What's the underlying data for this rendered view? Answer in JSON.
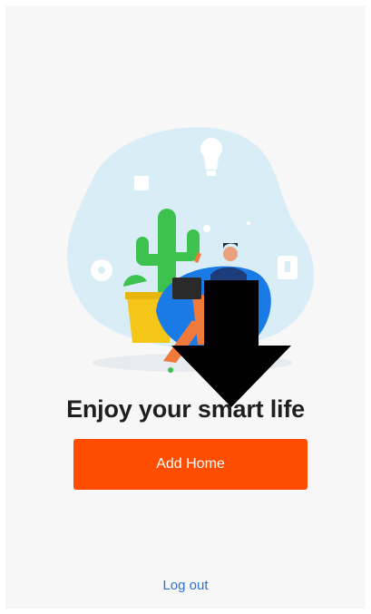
{
  "headline": "Enjoy your smart life",
  "add_home_label": "Add Home",
  "logout_label": "Log out",
  "colors": {
    "background": "#f7f7f7",
    "primary_button": "#ff4d00",
    "link": "#2f6fd6",
    "headline": "#1f1f1f"
  },
  "icons": [
    "smart-home-illustration",
    "down-arrow-icon"
  ]
}
